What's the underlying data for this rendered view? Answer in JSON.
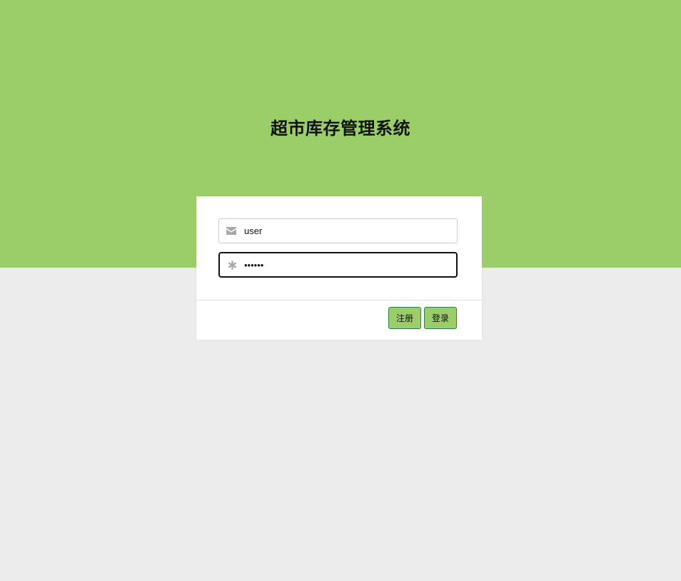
{
  "header": {
    "title": "超市库存管理系统"
  },
  "login_form": {
    "username": {
      "value": "user",
      "icon": "envelope-icon"
    },
    "password": {
      "value": "••••••",
      "icon": "asterisk-icon"
    },
    "register_label": "注册",
    "login_label": "登录"
  },
  "colors": {
    "hero_background": "#9bce69",
    "page_background": "#ebebeb",
    "button_border": "#2f7a4c"
  }
}
